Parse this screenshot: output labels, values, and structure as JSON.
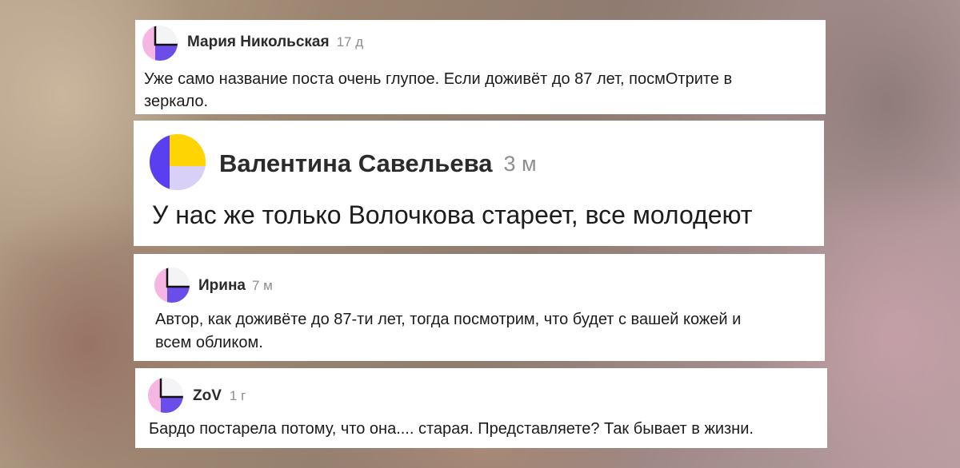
{
  "comments": [
    {
      "author": "Мария Никольская",
      "time": "17 д",
      "text_line1": "Уже само название поста очень глупое. Если доживёт до 87 лет, посмОтрите в",
      "text_line2": "зеркало.",
      "avatar_icon": "user-avatar-icon"
    },
    {
      "author": "Валентина Савельева",
      "time": "3 м",
      "text_line1": "У нас же только Волочкова стареет, все молодеют",
      "avatar_icon": "user-avatar-icon"
    },
    {
      "author": "Ирина",
      "time": "7 м",
      "text_line1": "Автор, как доживёте до 87-ти лет, тогда посмотрим, что будет с вашей кожей и",
      "text_line2": "всем обликом.",
      "avatar_icon": "user-avatar-icon"
    },
    {
      "author": "ZoV",
      "time": "1 г",
      "text_line1": "Бардо постарела потому, что она.... старая. Представляете? Так бывает в жизни.",
      "avatar_icon": "user-avatar-icon"
    }
  ],
  "colors": {
    "avatar_pink": "#f6b6e3",
    "avatar_purple": "#6b4eea",
    "avatar_lavender": "#d9d0f7",
    "avatar_yellow": "#ffd400",
    "avatar_blue": "#5a3ff0",
    "time_gray": "#8e8e93"
  }
}
